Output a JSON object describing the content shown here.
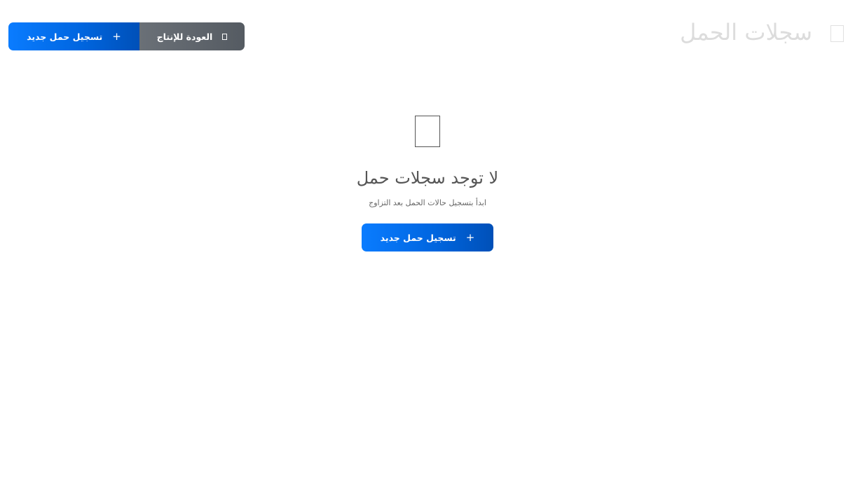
{
  "header": {
    "title": "سجلات الحمل",
    "title_icon": "pregnancy-records-icon",
    "buttons": {
      "new_record_label": "تسجيل حمل جديد",
      "new_record_icon": "+",
      "back_label": "العودة للإنتاج",
      "back_icon": "back-icon"
    }
  },
  "empty_state": {
    "icon": "empty-records-icon",
    "title": "لا توجد سجلات حمل",
    "subtitle": "ابدأ بتسجيل حالات الحمل بعد التزاوج",
    "button_label": "تسجيل حمل جديد",
    "button_icon": "+"
  },
  "colors": {
    "primary": "#0a7cff",
    "primary_dark": "#0050b8",
    "secondary": "#5f656c",
    "title_muted": "#dcdcdc",
    "text": "#555555"
  }
}
